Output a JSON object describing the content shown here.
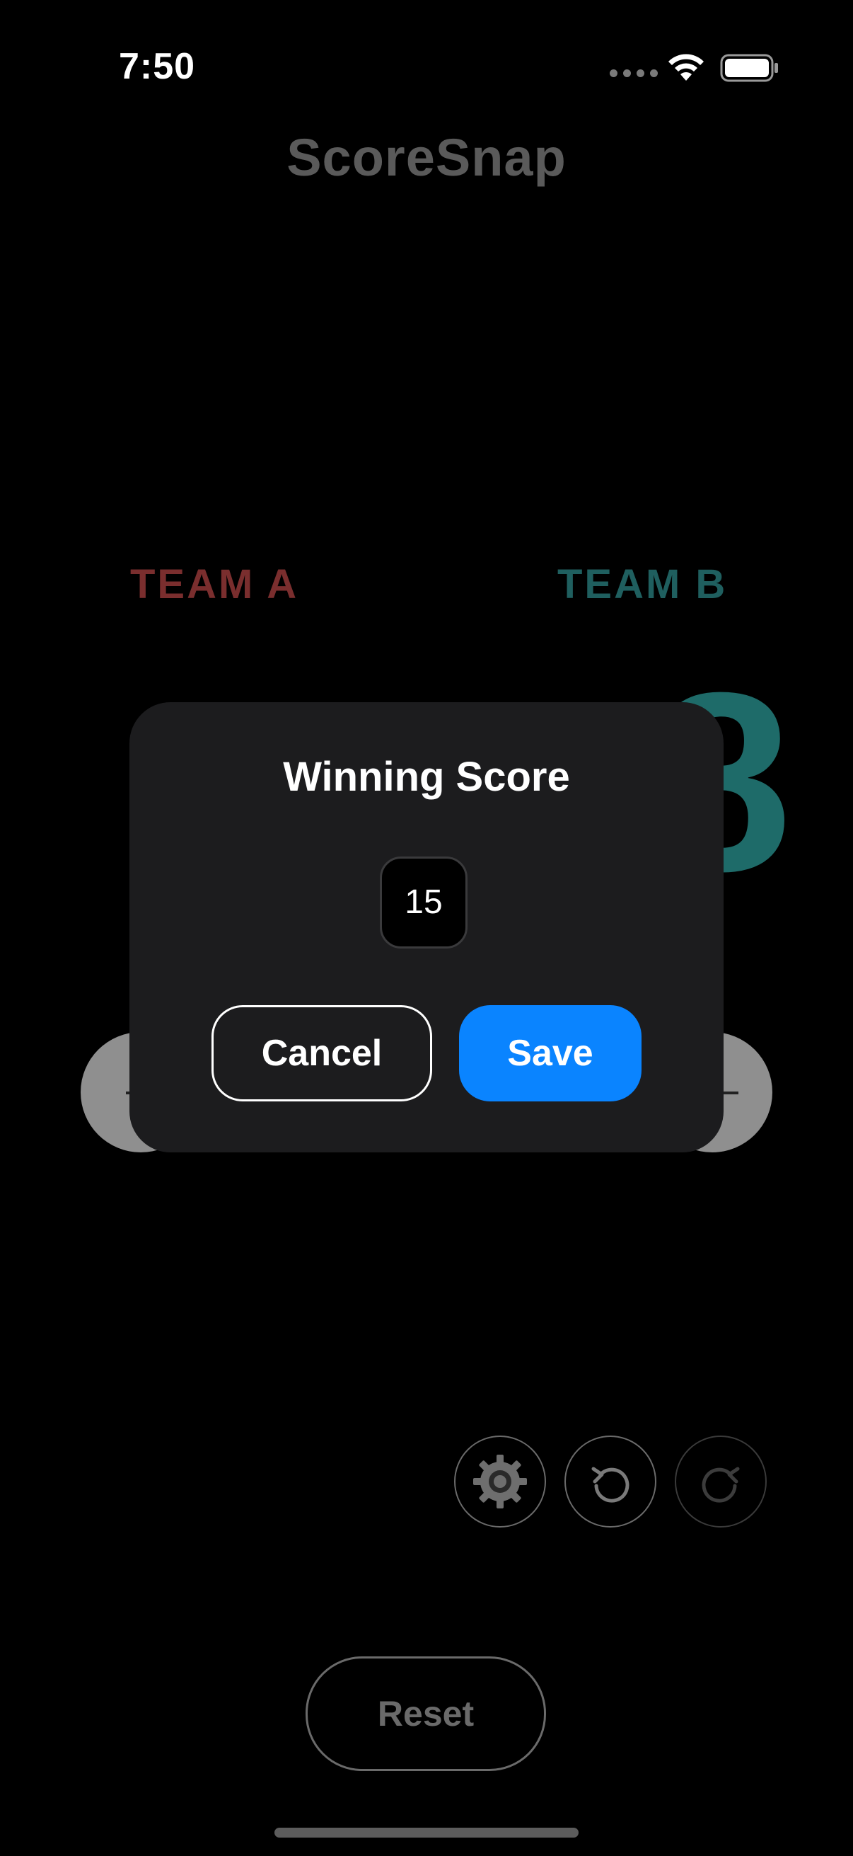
{
  "status_bar": {
    "time": "7:50"
  },
  "app": {
    "title": "ScoreSnap"
  },
  "teams": {
    "a": {
      "label": "TEAM A",
      "color": "#7a2e2e"
    },
    "b": {
      "label": "TEAM B",
      "score": "8",
      "color": "#1f5f5f"
    }
  },
  "dialog": {
    "title": "Winning Score",
    "input_value": "15",
    "cancel_label": "Cancel",
    "save_label": "Save",
    "save_color": "#0a84ff"
  },
  "toolbar": {
    "icons": [
      "gear-icon",
      "undo-icon",
      "redo-icon"
    ]
  },
  "reset_label": "Reset"
}
